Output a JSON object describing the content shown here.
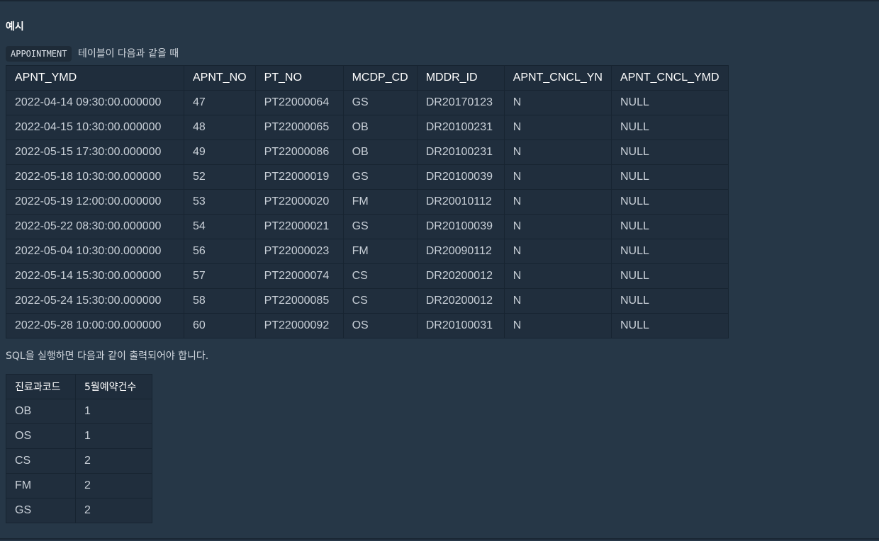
{
  "example": {
    "heading": "예시",
    "table_name": "APPOINTMENT",
    "intro_text": "테이블이 다음과 같을 때"
  },
  "appointment": {
    "columns": [
      "APNT_YMD",
      "APNT_NO",
      "PT_NO",
      "MCDP_CD",
      "MDDR_ID",
      "APNT_CNCL_YN",
      "APNT_CNCL_YMD"
    ],
    "rows": [
      [
        "2022-04-14 09:30:00.000000",
        "47",
        "PT22000064",
        "GS",
        "DR20170123",
        "N",
        "NULL"
      ],
      [
        "2022-04-15 10:30:00.000000",
        "48",
        "PT22000065",
        "OB",
        "DR20100231",
        "N",
        "NULL"
      ],
      [
        "2022-05-15 17:30:00.000000",
        "49",
        "PT22000086",
        "OB",
        "DR20100231",
        "N",
        "NULL"
      ],
      [
        "2022-05-18 10:30:00.000000",
        "52",
        "PT22000019",
        "GS",
        "DR20100039",
        "N",
        "NULL"
      ],
      [
        "2022-05-19 12:00:00.000000",
        "53",
        "PT22000020",
        "FM",
        "DR20010112",
        "N",
        "NULL"
      ],
      [
        "2022-05-22 08:30:00.000000",
        "54",
        "PT22000021",
        "GS",
        "DR20100039",
        "N",
        "NULL"
      ],
      [
        "2022-05-04 10:30:00.000000",
        "56",
        "PT22000023",
        "FM",
        "DR20090112",
        "N",
        "NULL"
      ],
      [
        "2022-05-14 15:30:00.000000",
        "57",
        "PT22000074",
        "CS",
        "DR20200012",
        "N",
        "NULL"
      ],
      [
        "2022-05-24 15:30:00.000000",
        "58",
        "PT22000085",
        "CS",
        "DR20200012",
        "N",
        "NULL"
      ],
      [
        "2022-05-28 10:00:00.000000",
        "60",
        "PT22000092",
        "OS",
        "DR20100031",
        "N",
        "NULL"
      ]
    ]
  },
  "result": {
    "intro_text": "SQL을 실행하면 다음과 같이 출력되어야 합니다.",
    "columns": [
      "진료과코드",
      "5월예약건수"
    ],
    "rows": [
      [
        "OB",
        "1"
      ],
      [
        "OS",
        "1"
      ],
      [
        "CS",
        "2"
      ],
      [
        "FM",
        "2"
      ],
      [
        "GS",
        "2"
      ]
    ]
  },
  "colors": {
    "background": "#263747",
    "table_cell": "#202e3d",
    "table_header": "#1f2d3c",
    "border": "#172431"
  }
}
